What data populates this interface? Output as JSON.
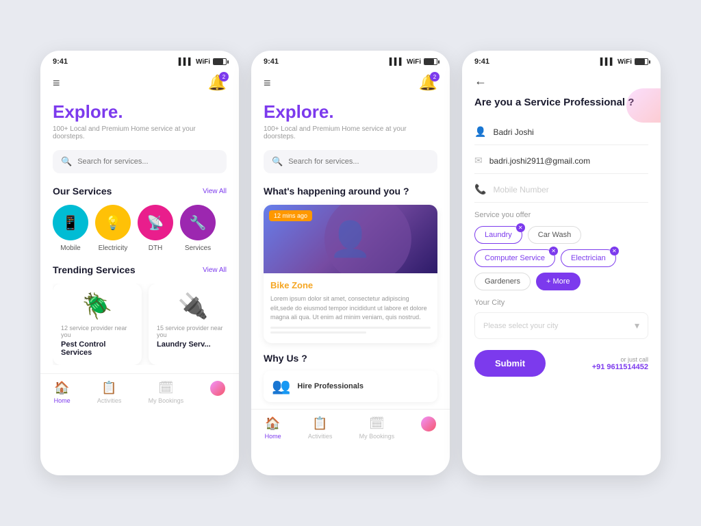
{
  "screen1": {
    "status_time": "9:41",
    "menu_icon": "≡",
    "bell_count": "2",
    "title": "Explore",
    "title_dot": ".",
    "subtitle": "100+ Local and Premium Home service at your doorsteps.",
    "search_placeholder": "Search for services...",
    "services_label": "Our Services",
    "view_all": "View All",
    "services": [
      {
        "label": "Mobile",
        "icon": "📱",
        "color": "circle-teal"
      },
      {
        "label": "Electricity",
        "icon": "💡",
        "color": "circle-yellow"
      },
      {
        "label": "DTH",
        "icon": "📡",
        "color": "circle-pink"
      },
      {
        "label": "Services",
        "icon": "🔧",
        "color": "circle-purple"
      }
    ],
    "trending_label": "Trending Services",
    "view_all_2": "View All",
    "trending_cards": [
      {
        "icon": "🪲",
        "count": "12 service provider near you",
        "title": "Pest Control Services"
      },
      {
        "icon": "🔌",
        "count": "15 service provider near you",
        "title": "Laundry Serv..."
      }
    ],
    "nav": [
      {
        "label": "Home",
        "icon": "🏠",
        "active": true
      },
      {
        "label": "Activities",
        "icon": "📋",
        "active": false
      },
      {
        "label": "My Bookings",
        "icon": "🗓",
        "active": false
      }
    ]
  },
  "screen2": {
    "status_time": "9:41",
    "bell_count": "2",
    "title": "Explore",
    "subtitle": "100+ Local and Premium Home service at your doorsteps.",
    "search_placeholder": "Search for services...",
    "what_happening": "What's happening around you ?",
    "time_badge": "12 mins ago",
    "news_title": "Bike Zone",
    "news_text": "Lorem ipsum dolor sit amet, consectetur adipiscing elit,sede do eiusmod tempor incididunt ut labore et dolore magna ali qua. Ut enim ad minim veniam, quis nostrud.",
    "why_us": "Why Us ?",
    "hire_label": "Hire Professionals",
    "nav": [
      {
        "label": "Home",
        "icon": "🏠",
        "active": true
      },
      {
        "label": "Activities",
        "icon": "📋",
        "active": false
      },
      {
        "label": "My Bookings",
        "icon": "🗓",
        "active": false
      }
    ]
  },
  "screen3": {
    "status_time": "9:41",
    "page_title": "Are you a Service Professional ?",
    "name": "Badri Joshi",
    "email": "badri.joshi2911@gmail.com",
    "mobile_placeholder": "Mobile Number",
    "service_label": "Service you offer",
    "tags": [
      {
        "text": "Laundry",
        "selected": true,
        "fill": false
      },
      {
        "text": "Car Wash",
        "selected": false,
        "fill": false
      },
      {
        "text": "Computer Service",
        "selected": true,
        "fill": false
      },
      {
        "text": "Electrician",
        "selected": true,
        "fill": false
      },
      {
        "text": "Gardeners",
        "selected": false,
        "fill": false
      },
      {
        "text": "+ More",
        "selected": false,
        "fill": true
      }
    ],
    "city_label": "Your City",
    "city_placeholder": "Please select your city",
    "submit_label": "Submit",
    "or_call": "or just call",
    "phone": "+91 9611514452"
  }
}
